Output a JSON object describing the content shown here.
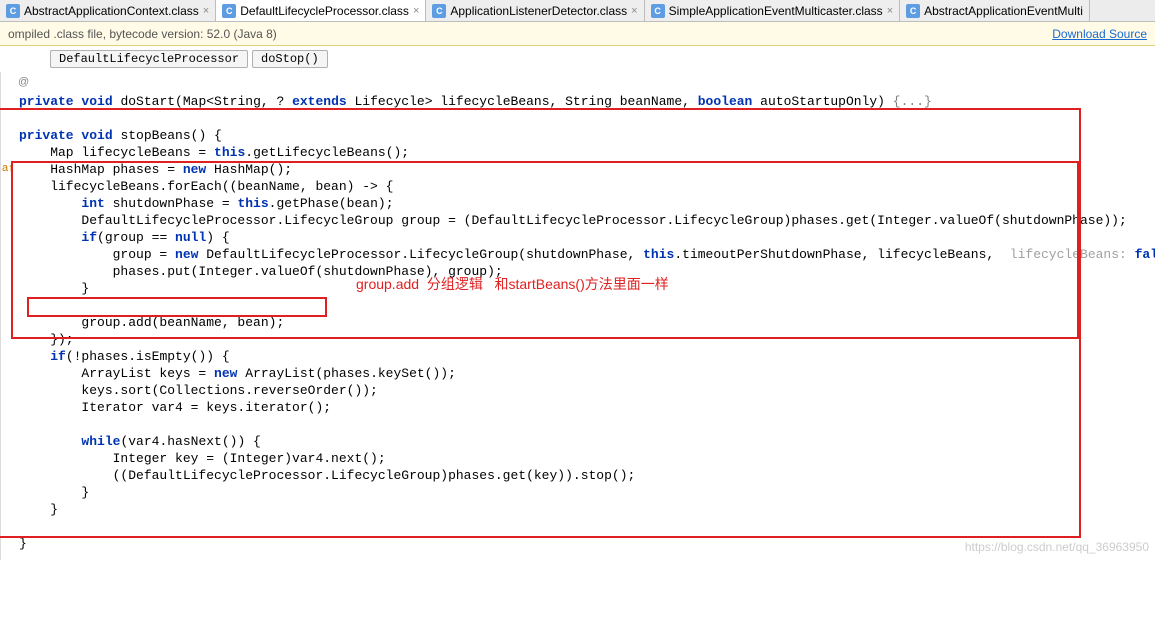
{
  "tabs": [
    {
      "label": "AbstractApplicationContext.class"
    },
    {
      "label": "DefaultLifecycleProcessor.class"
    },
    {
      "label": "ApplicationListenerDetector.class"
    },
    {
      "label": "SimpleApplicationEventMulticaster.class"
    },
    {
      "label": "AbstractApplicationEventMulti"
    }
  ],
  "info": {
    "text": "ompiled .class file, bytecode version: 52.0 (Java 8)",
    "download": "Download Source"
  },
  "breadcrumb": {
    "class": "DefaultLifecycleProcessor",
    "method": "doStop()"
  },
  "kw": {
    "private": "private",
    "void": "void",
    "this": "this",
    "new": "new",
    "int": "int",
    "if": "if",
    "null": "null",
    "boolean": "boolean",
    "extends": "extends",
    "false": "false",
    "while": "while"
  },
  "code": {
    "l1a": " doStart(Map<String, ? ",
    "l1b": " Lifecycle> lifecycleBeans, String beanName, ",
    "l1c": " autoStartupOnly) ",
    "l1fold": "{...}",
    "l2": " stopBeans() {",
    "l3a": "    Map lifecycleBeans = ",
    "l3b": ".getLifecycleBeans();",
    "l4a": "    HashMap phases = ",
    "l4b": " HashMap();",
    "l5": "    lifecycleBeans.forEach((beanName, bean) -> {",
    "l6a": "        ",
    "l6b": " shutdownPhase = ",
    "l6c": ".getPhase(bean);",
    "l7": "        DefaultLifecycleProcessor.LifecycleGroup group = (DefaultLifecycleProcessor.LifecycleGroup)phases.get(Integer.valueOf(shutdownPhase));",
    "l8a": "        ",
    "l8b": "(group == ",
    "l8c": ") {",
    "l9a": "            group = ",
    "l9b": " DefaultLifecycleProcessor.LifecycleGroup(shutdownPhase, ",
    "l9c": ".timeoutPerShutdownPhase, lifecycleBeans, ",
    "l9hint": " lifecycleBeans: ",
    "l9d": ");",
    "l10": "            phases.put(Integer.valueOf(shutdownPhase), group);",
    "l11": "        }",
    "l13": "        group.add(beanName, bean);",
    "l14": "    });",
    "l15a": "    ",
    "l15b": "(!phases.isEmpty()) {",
    "l16a": "        ArrayList keys = ",
    "l16b": " ArrayList(phases.keySet());",
    "l17": "        keys.sort(Collections.reverseOrder());",
    "l18": "        Iterator var4 = keys.iterator();",
    "l20a": "        ",
    "l20b": "(var4.hasNext()) {",
    "l21": "            Integer key = (Integer)var4.next();",
    "l22": "            ((DefaultLifecycleProcessor.LifecycleGroup)phases.get(key)).stop();",
    "l23": "        }",
    "l24": "    }",
    "l26": "}"
  },
  "annotation": "group.add  分组逻辑   和startBeans()方法里面一样",
  "gutter": {
    "at": "@",
    "warn": "a↑"
  },
  "watermark": "https://blog.csdn.net/qq_36963950"
}
